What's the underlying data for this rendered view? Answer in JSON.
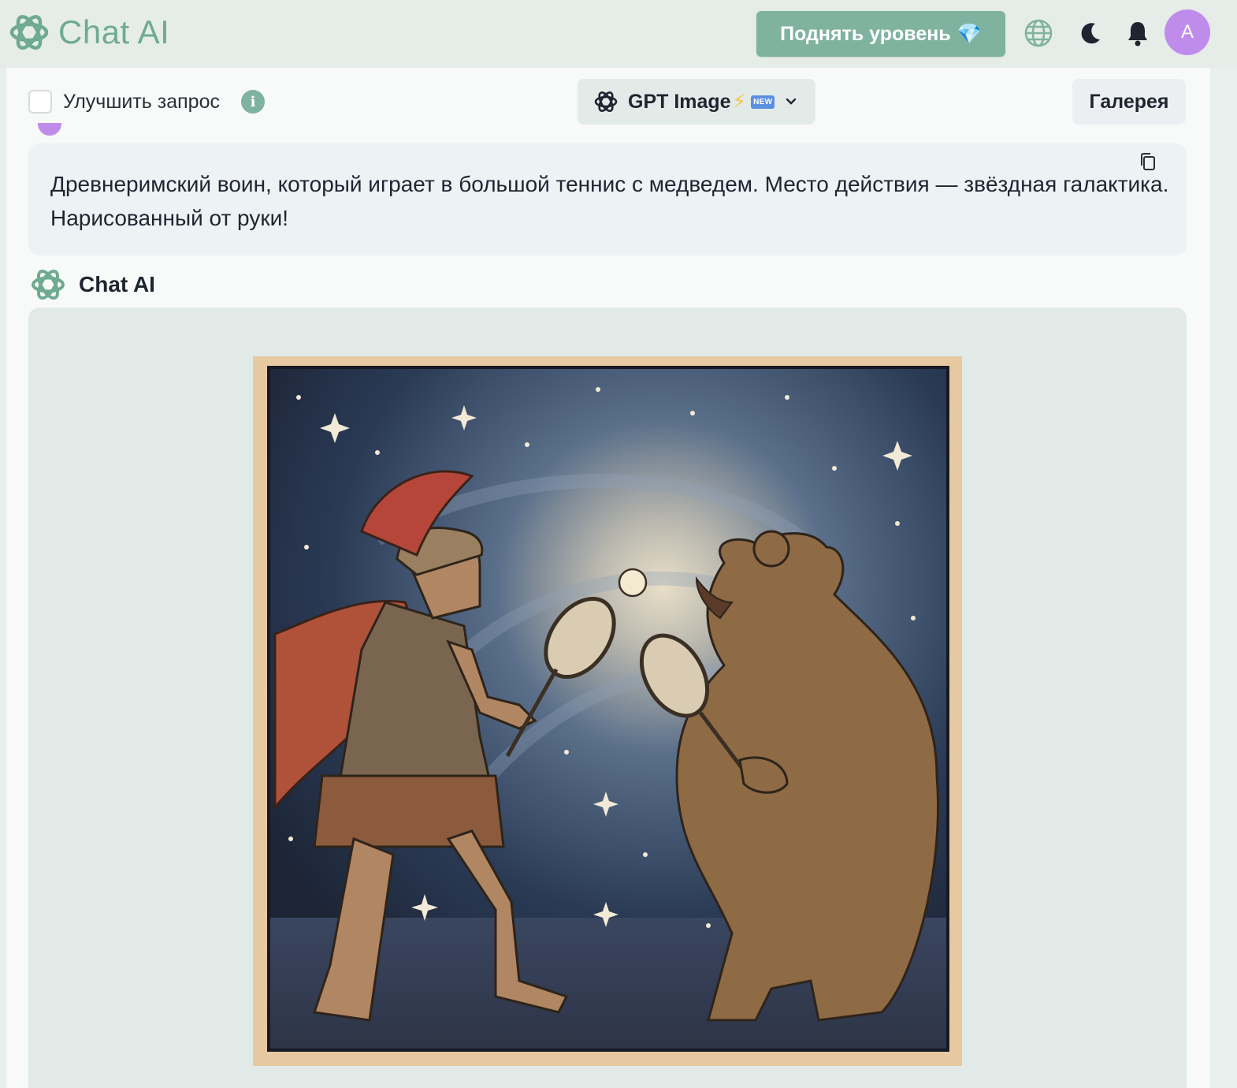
{
  "app": {
    "brand_name": "Chat AI",
    "upgrade_label": "Поднять уровень",
    "upgrade_gem": "💎",
    "avatar_letter": "A",
    "accent_color": "#7fb39f",
    "avatar_color": "#c08ceb"
  },
  "toolbar": {
    "improve_label": "Улучшить запрос",
    "improve_checked": false,
    "info_symbol": "i",
    "model_name": "GPT Image",
    "model_bolt": "⚡",
    "model_new_tag": "NEW",
    "gallery_label": "Галерея"
  },
  "chat": {
    "user_prompt": "Древнеримский воин, который играет в большой теннис с медведем. Место действия — звёздная галактика. Нарисованный от руки!",
    "assistant_name": "Chat AI"
  },
  "icons": [
    "openai-logo-icon",
    "globe-icon",
    "moon-icon",
    "bell-icon",
    "info-icon",
    "chevron-down-icon",
    "copy-icon"
  ]
}
